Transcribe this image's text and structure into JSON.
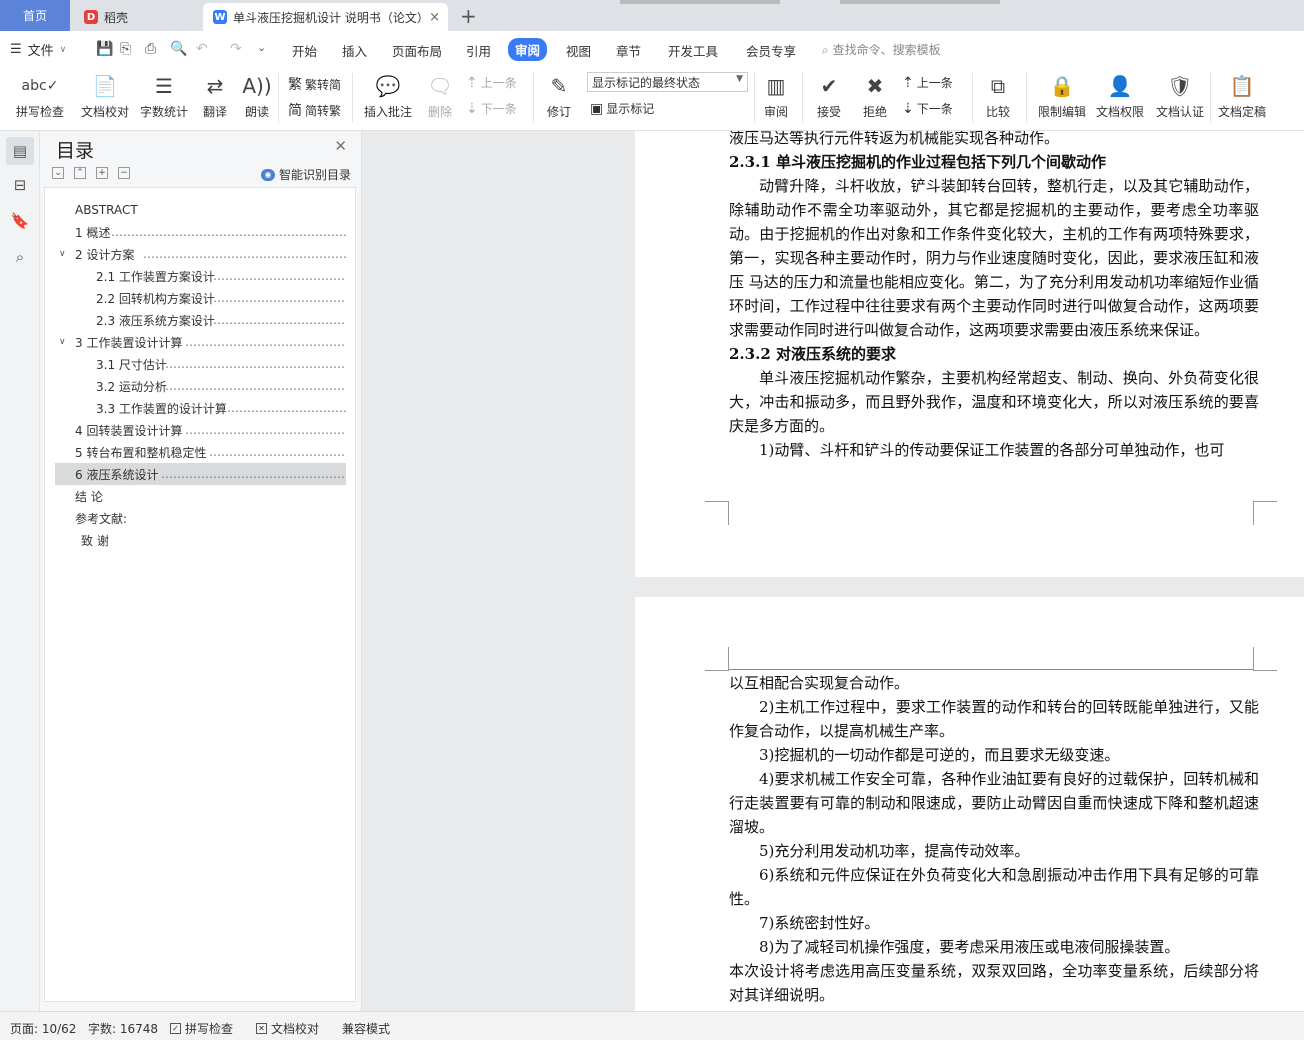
{
  "tabs": {
    "home": "首页",
    "tab1": "稻壳",
    "tab2": "单斗液压挖掘机设计 说明书（论文）",
    "add": "+",
    "close": "×"
  },
  "menu": {
    "file": "文件",
    "items": [
      "开始",
      "插入",
      "页面布局",
      "引用",
      "审阅",
      "视图",
      "章节",
      "开发工具",
      "会员专享"
    ],
    "active": "审阅",
    "search": "查找命令、搜索模板"
  },
  "ribbon": {
    "spell": "拼写检查",
    "proof": "文档校对",
    "wordcount": "字数统计",
    "translate": "翻译",
    "read": "朗读",
    "t2s": "繁转简",
    "s2t": "简转繁",
    "insert_comment": "插入批注",
    "delete": "删除",
    "prev_comment": "上一条",
    "next_comment": "下一条",
    "track": "修订",
    "markup_state": "显示标记的最终状态",
    "show_markup": "显示标记",
    "review": "审阅",
    "accept": "接受",
    "reject": "拒绝",
    "prev_change": "上一条",
    "next_change": "下一条",
    "compare": "比较",
    "restrict": "限制编辑",
    "permission": "文档权限",
    "certify": "文档认证",
    "finalize": "文档定稿"
  },
  "toc": {
    "title": "目录",
    "smart": "智能识别目录",
    "items": [
      {
        "label": "ABSTRACT",
        "lead": ""
      },
      {
        "label": "1  概述",
        "lead": "…………………………………………………………………………………"
      },
      {
        "label": "2  设计方案",
        "lead": "……………………………………………………………………………"
      },
      {
        "label": "2.1  工作装置方案设计",
        "lead": "……………………………………………………………"
      },
      {
        "label": "2.2  回转机构方案设计",
        "lead": "……………………………………………………………"
      },
      {
        "label": "2.3  液压系统方案设计",
        "lead": "……………………………………………………………"
      },
      {
        "label": "3  工作装置设计计算",
        "lead": "………………………………………………………………"
      },
      {
        "label": "3.1  尺寸估计",
        "lead": "………………………………………………………………………"
      },
      {
        "label": "3.2  运动分析",
        "lead": "………………………………………………………………………"
      },
      {
        "label": "3.3  工作装置的设计计算",
        "lead": "…………………………………………………………"
      },
      {
        "label": "4  回转装置设计计算",
        "lead": "………………………………………………………………"
      },
      {
        "label": "5  转台布置和整机稳定性",
        "lead": "…………………………………………………………"
      },
      {
        "label": "6  液压系统设计",
        "lead": "……………………………………………………………………"
      },
      {
        "label": "结      论",
        "lead": ""
      },
      {
        "label": "参考文献:",
        "lead": ""
      },
      {
        "label": "致    谢",
        "lead": ""
      }
    ]
  },
  "doc": {
    "p1_top": "液压马达等执行元件转返为机械能实现各种动作。",
    "h231": "2.3.1 单斗液压挖掘机的作业过程包括下列几个间歇动作",
    "para1": "动臂升降，斗杆收放，铲斗装卸转台回转，整机行走，以及其它辅助动作，除辅助动作不需全功率驱动外，其它都是挖掘机的主要动作，要考虑全功率驱动。由于挖掘机的作出对象和工作条件变化较大，主机的工作有两项特殊要求，第一，实现各种主要动作时，阴力与作业速度随时变化，因此，要求液压缸和液压 马达的压力和流量也能相应变化。第二，为了充分利用发动机功率缩短作业循环时间，工作过程中往往要求有两个主要动作同时进行叫做复合动作，这两项要求需要动作同时进行叫做复合动作，这两项要求需要由液压系统来保证。",
    "h232": "2.3.2 对液压系统的要求",
    "para2": "单斗液压挖掘机动作繁杂，主要机构经常超支、制动、换向、外负荷变化很大，冲击和振动多，而且野外我作，温度和环境变化大，所以对液压系统的要喜庆是多方面的。",
    "req1a": "1)动臂、斗杆和铲斗的传动要保证工作装置的各部分可单独动作，也可",
    "req1b": "以互相配合实现复合动作。",
    "req2": "2)主机工作过程中，要求工作装置的动作和转台的回转既能单独进行，又能作复合动作，以提高机械生产率。",
    "req3": "3)挖掘机的一切动作都是可逆的，而且要求无级变速。",
    "req4": "4)要求机械工作安全可靠，各种作业油缸要有良好的过载保护，回转机械和行走装置要有可靠的制动和限速成，要防止动臂因自重而快速成下降和整机超速溜坡。",
    "req5": "5)充分利用发动机功率，提高传动效率。",
    "req6": "6)系统和元件应保证在外负荷变化大和急剧振动冲击作用下具有足够的可靠性。",
    "req7": "7)系统密封性好。",
    "req8": "8)为了减轻司机操作强度，要考虑采用液压或电液伺服操装置。",
    "final": "本次设计将考虑选用高压变量系统，双泵双回路，全功率变量系统，后续部分将对其详细说明。"
  },
  "status": {
    "page": "页面: 10/62",
    "words": "字数: 16748",
    "spell": "拼写检查",
    "proof": "文档校对",
    "compat": "兼容模式"
  },
  "colors": {
    "accent": "#3a7bf5",
    "home_tab": "#5b84d8",
    "workspace": "#e9eaec"
  }
}
